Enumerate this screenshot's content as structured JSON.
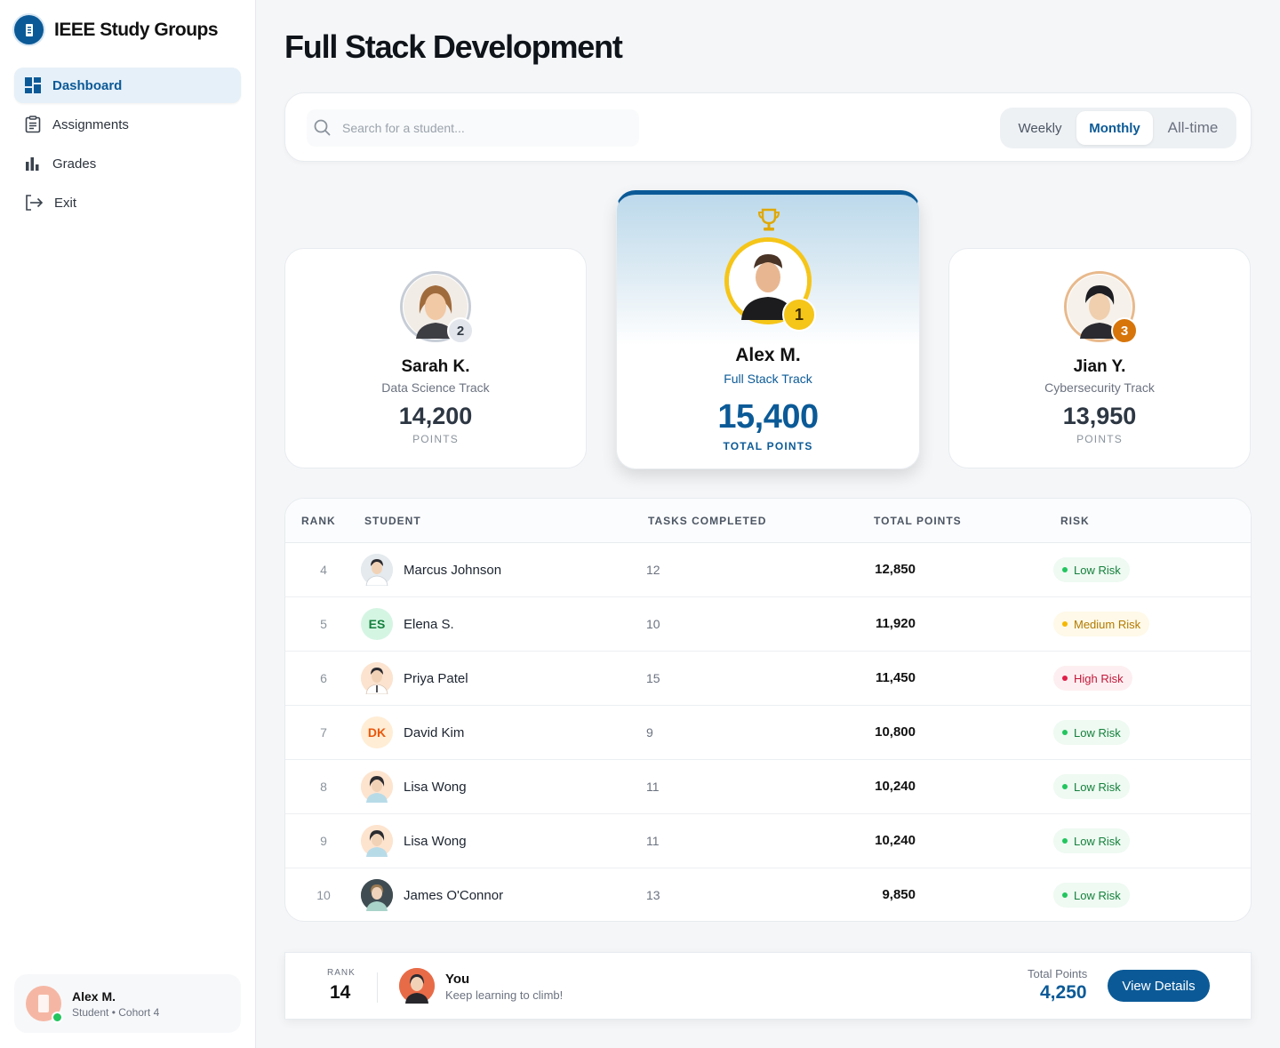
{
  "brand": {
    "title": "IEEE Study Groups"
  },
  "sidebar": {
    "items": [
      {
        "label": "Dashboard",
        "icon": "dashboard-icon",
        "active": true
      },
      {
        "label": "Assignments",
        "icon": "clipboard-icon",
        "active": false
      },
      {
        "label": "Grades",
        "icon": "bar-chart-icon",
        "active": false
      },
      {
        "label": "Exit",
        "icon": "exit-icon",
        "active": false
      }
    ],
    "user": {
      "name": "Alex M.",
      "subtitle": "Student • Cohort 4"
    }
  },
  "page": {
    "title": "Full Stack Development"
  },
  "toolbar": {
    "search_placeholder": "Search for a student...",
    "periods": [
      "Weekly",
      "Monthly",
      "All-time"
    ],
    "selected_period": "Monthly"
  },
  "podium": {
    "first": {
      "rank": "1",
      "name": "Alex M.",
      "track": "Full Stack Track",
      "points": "15,400",
      "label": "TOTAL POINTS"
    },
    "second": {
      "rank": "2",
      "name": "Sarah K.",
      "track": "Data Science Track",
      "points": "14,200",
      "label": "POINTS"
    },
    "third": {
      "rank": "3",
      "name": "Jian Y.",
      "track": "Cybersecurity Track",
      "points": "13,950",
      "label": "POINTS"
    }
  },
  "table": {
    "headers": {
      "rank": "RANK",
      "student": "STUDENT",
      "tasks": "TASKS COMPLETED",
      "points": "TOTAL POINTS",
      "risk": "RISK"
    },
    "rows": [
      {
        "rank": "4",
        "name": "Marcus Johnson",
        "initials": "",
        "tasks": "12",
        "points": "12,850",
        "risk": "Low Risk"
      },
      {
        "rank": "5",
        "name": "Elena S.",
        "initials": "ES",
        "tasks": "10",
        "points": "11,920",
        "risk": "Medium Risk"
      },
      {
        "rank": "6",
        "name": "Priya Patel",
        "initials": "",
        "tasks": "15",
        "points": "11,450",
        "risk": "High Risk"
      },
      {
        "rank": "7",
        "name": "David Kim",
        "initials": "DK",
        "tasks": "9",
        "points": "10,800",
        "risk": "Low Risk"
      },
      {
        "rank": "8",
        "name": "Lisa Wong",
        "initials": "",
        "tasks": "11",
        "points": "10,240",
        "risk": "Low Risk"
      },
      {
        "rank": "9",
        "name": "Lisa Wong",
        "initials": "",
        "tasks": "11",
        "points": "10,240",
        "risk": "Low Risk"
      },
      {
        "rank": "10",
        "name": "James O'Connor",
        "initials": "",
        "tasks": "13",
        "points": "9,850",
        "risk": "Low Risk"
      }
    ]
  },
  "you": {
    "rank_label": "RANK",
    "rank": "14",
    "name": "You",
    "subtitle": "Keep learning to climb!",
    "points_label": "Total Points",
    "points": "4,250",
    "button": "View Details"
  },
  "colors": {
    "primary": "#0b5a97",
    "gold": "#f5c518",
    "bronze": "#d7750a",
    "low": "#22c55e",
    "medium": "#f5b800",
    "high": "#e11d48"
  }
}
